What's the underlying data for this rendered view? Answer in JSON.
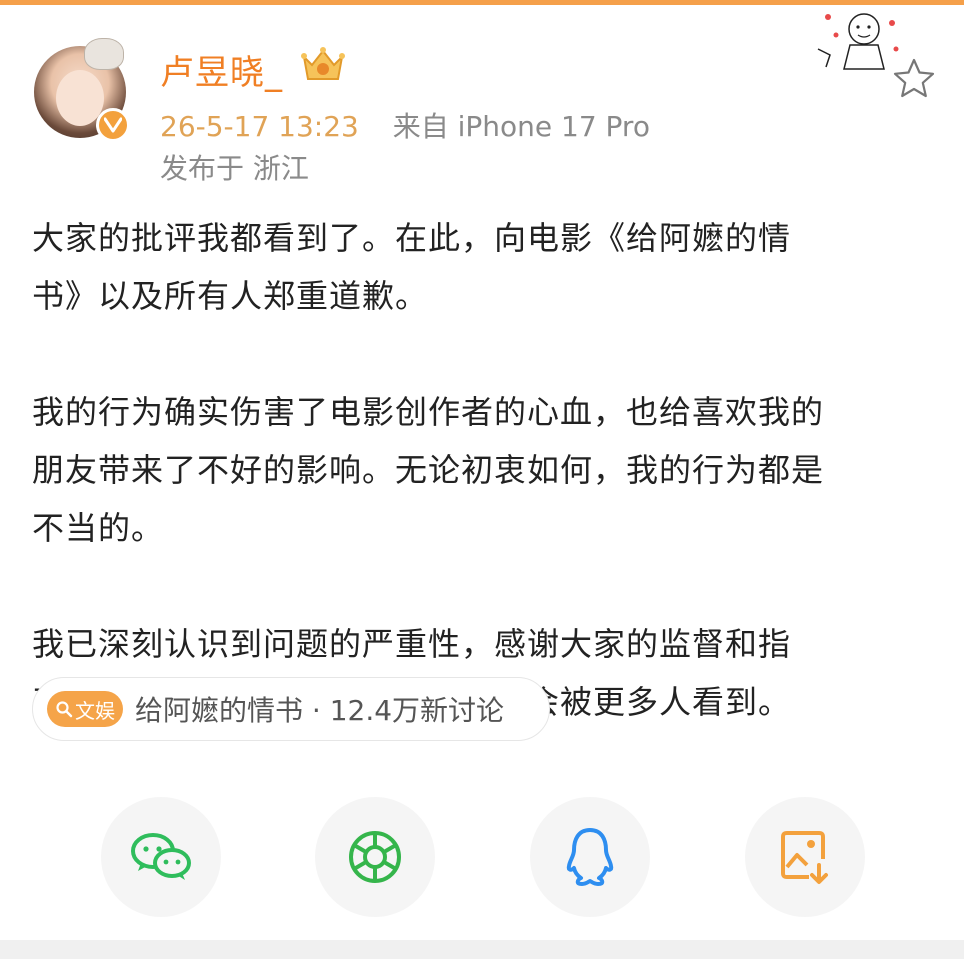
{
  "post": {
    "username": "卢昱晓_",
    "timestamp": "26-5-17 13:23",
    "source": "来自 iPhone 17 Pro",
    "location": "发布于 浙江",
    "paragraphs": [
      [
        "大家的批评我都看到了。在此，向电影《给阿嬷的情",
        "书》以及所有人郑重道歉。"
      ],
      [
        "我的行为确实伤害了电影创作者的心血，也给喜欢我的",
        "朋友带来了不好的影响。无论初衷如何，我的行为都是",
        "不当的。"
      ],
      [
        "我已深刻认识到问题的严重性，感谢大家的监督和指",
        "正。由衷希望这部有温度的好电影会被更多人看到。"
      ]
    ]
  },
  "topic": {
    "tag_label": "文娱",
    "text": "给阿嬷的情书 · 12.4万新讨论"
  },
  "share": {
    "buttons": [
      {
        "name": "wechat-icon",
        "color": "#2fbd5c"
      },
      {
        "name": "moments-icon",
        "color": "#35b54b"
      },
      {
        "name": "qq-icon",
        "color": "#2e8ef0"
      },
      {
        "name": "save-image-icon",
        "color": "#f3a13d"
      }
    ]
  },
  "colors": {
    "accent": "#f07f24",
    "time": "#e0a356",
    "meta": "#8a8a8a",
    "body_text": "#222222"
  }
}
